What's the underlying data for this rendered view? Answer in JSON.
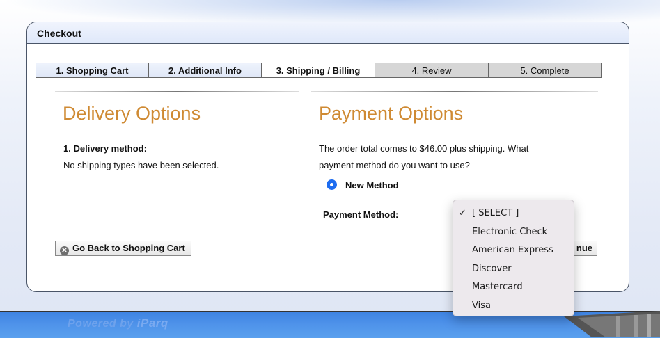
{
  "panel": {
    "title": "Checkout"
  },
  "steps": [
    {
      "label": "1. Shopping Cart",
      "state": "done"
    },
    {
      "label": "2. Additional Info",
      "state": "done"
    },
    {
      "label": "3. Shipping / Billing",
      "state": "active"
    },
    {
      "label": "4. Review",
      "state": "todo"
    },
    {
      "label": "5. Complete",
      "state": "todo"
    }
  ],
  "delivery": {
    "title": "Delivery Options",
    "method_label": "1. Delivery method:",
    "method_text": "No shipping types have been selected."
  },
  "payment": {
    "title": "Payment Options",
    "prompt_line1": "The order total comes to $46.00 plus shipping. What",
    "prompt_line2": "payment method do you want to use?",
    "radio_label": "New Method",
    "method_label": "Payment Method:",
    "continue_fragment": "nue"
  },
  "buttons": {
    "back_label": "Go Back to Shopping Cart",
    "back_icon": "close-circle-icon"
  },
  "dropdown": {
    "selected": "[ SELECT ]",
    "check_mark": "✓",
    "options": [
      "[ SELECT ]",
      "Electronic Check",
      "American Express",
      "Discover",
      "Mastercard",
      "Visa"
    ]
  },
  "footer": {
    "powered_prefix": "Powered by",
    "brand": "iParq"
  },
  "colors": {
    "accent_title": "#cf8a33",
    "radio": "#1d6cf0",
    "footer": "#4a8ee8"
  }
}
